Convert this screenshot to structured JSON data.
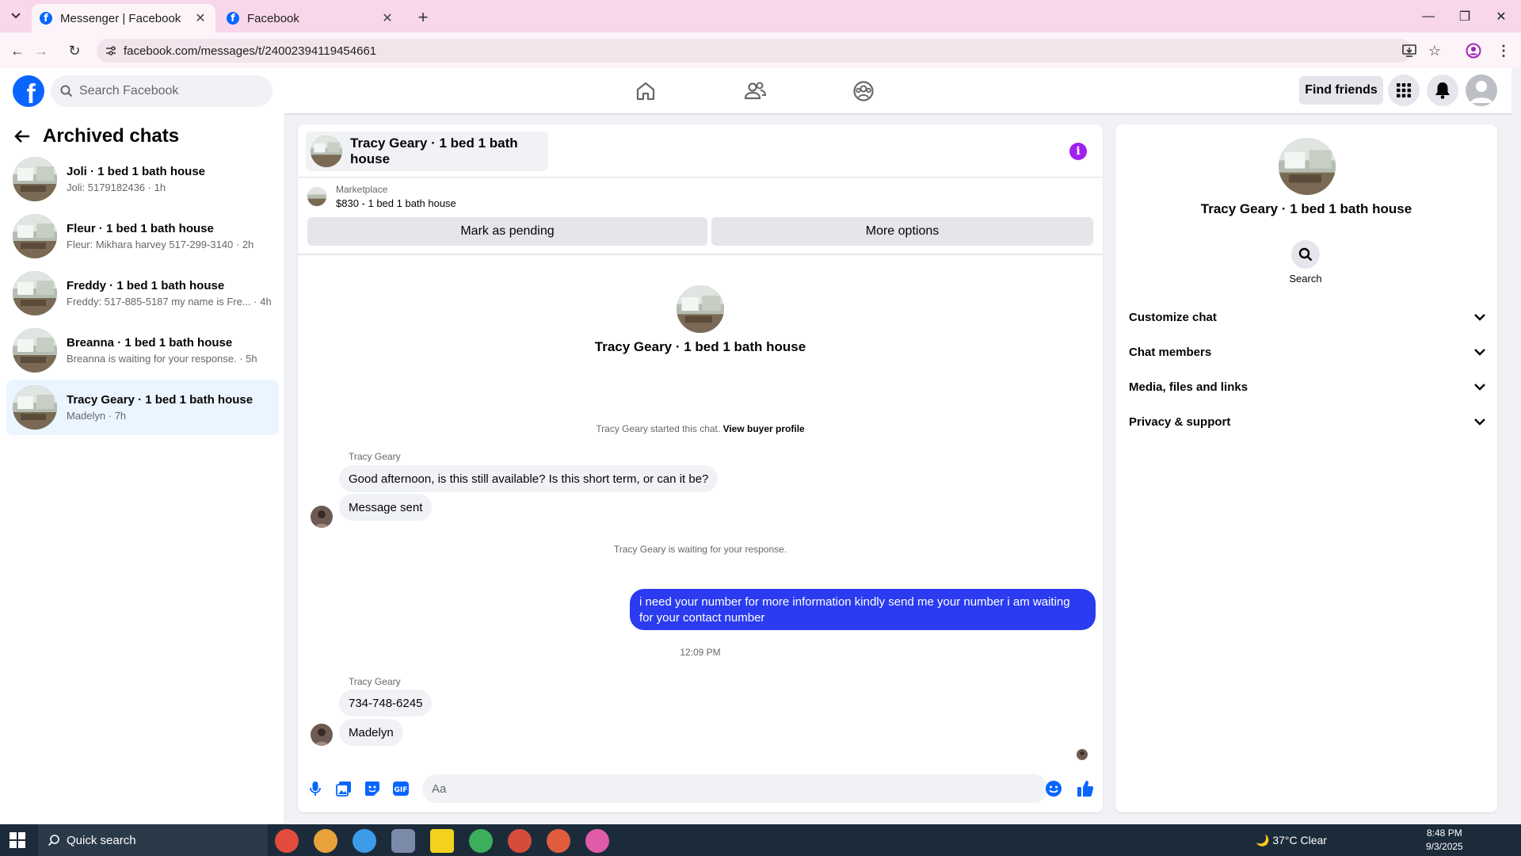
{
  "browser": {
    "tabs": [
      {
        "title": "Messenger | Facebook",
        "active": true
      },
      {
        "title": "Facebook",
        "active": false
      }
    ],
    "url": "facebook.com/messages/t/24002394119454661"
  },
  "header": {
    "search_placeholder": "Search Facebook",
    "find_friends": "Find friends"
  },
  "sidebar": {
    "title": "Archived chats",
    "chats": [
      {
        "name": "Joli · 1 bed 1 bath house",
        "preview": "Joli: 5179182436 · 1h"
      },
      {
        "name": "Fleur · 1 bed 1 bath house",
        "preview": "Fleur: Mikhara harvey 517-299-3140 · 2h"
      },
      {
        "name": "Freddy · 1 bed 1 bath house",
        "preview": "Freddy: 517-885-5187 my name is Fre... · 4h"
      },
      {
        "name": "Breanna · 1 bed 1 bath house",
        "preview": "Breanna is waiting for your response. · 5h"
      },
      {
        "name": "Tracy Geary · 1 bed 1 bath house",
        "preview": "Madelyn · 7h"
      }
    ]
  },
  "chat": {
    "title": "Tracy Geary · 1 bed 1 bath house",
    "marketplace_label": "Marketplace",
    "listing": "$830 - 1 bed 1 bath house",
    "mark_pending": "Mark as pending",
    "more_options": "More options",
    "started": "Tracy Geary started this chat.",
    "view_profile": "View buyer profile",
    "sender1": "Tracy Geary",
    "msg1": "Good afternoon, is this still available? Is this short term, or can it be?",
    "msg2": "Message sent",
    "waiting": "Tracy Geary is waiting for your response.",
    "outgoing": "i need your number for more information kindly send me your number i am waiting for your contact number",
    "timestamp": "12:09 PM",
    "sender2": "Tracy Geary",
    "msg3": "734-748-6245",
    "msg4": "Madelyn",
    "input_placeholder": "Aa"
  },
  "right_panel": {
    "name": "Tracy Geary · 1 bed 1 bath house",
    "search_label": "Search",
    "sections": [
      "Customize chat",
      "Chat members",
      "Media, files and links",
      "Privacy & support"
    ]
  },
  "taskbar": {
    "search": "Quick search",
    "weather": "37°C  Clear",
    "time": "8:48 PM",
    "date": "9/3/2025"
  },
  "colors": {
    "fb_blue": "#0866ff",
    "outgoing_bubble": "#2a3bf0",
    "info_purple": "#a020f0"
  }
}
